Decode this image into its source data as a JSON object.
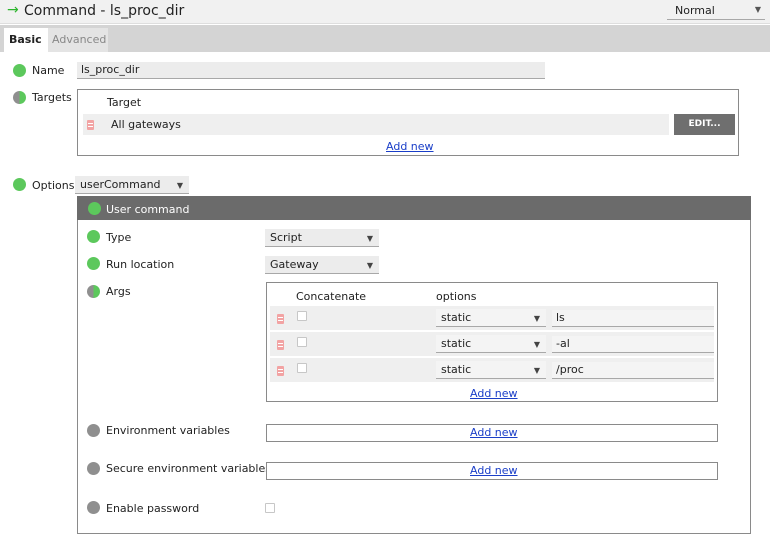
{
  "header": {
    "title": "Command - ls_proc_dir",
    "mode": "Normal"
  },
  "tabs": [
    {
      "label": "Basic",
      "active": true
    },
    {
      "label": "Advanced",
      "active": false
    }
  ],
  "name": {
    "label": "Name",
    "value": "ls_proc_dir"
  },
  "targets": {
    "label": "Targets",
    "column": "Target",
    "rows": [
      {
        "value": "All gateways",
        "edit_label": "EDIT..."
      }
    ],
    "add_new": "Add new"
  },
  "options": {
    "label": "Options",
    "value": "userCommand",
    "panel_title": "User command",
    "type": {
      "label": "Type",
      "value": "Script"
    },
    "run_location": {
      "label": "Run location",
      "value": "Gateway"
    },
    "args": {
      "label": "Args",
      "columns": [
        "Concatenate",
        "options"
      ],
      "rows": [
        {
          "option": "static",
          "value": "ls"
        },
        {
          "option": "static",
          "value": "-al"
        },
        {
          "option": "static",
          "value": "/proc"
        }
      ],
      "add_new": "Add new"
    },
    "env": {
      "label": "Environment variables",
      "add_new": "Add new"
    },
    "secure_env": {
      "label": "Secure environment variables",
      "add_new": "Add new"
    },
    "enable_password": {
      "label": "Enable password"
    }
  },
  "colors": {
    "accent_green": "#5cc85c",
    "panel_header": "#6b6b6b",
    "link": "#1a3ec8"
  }
}
